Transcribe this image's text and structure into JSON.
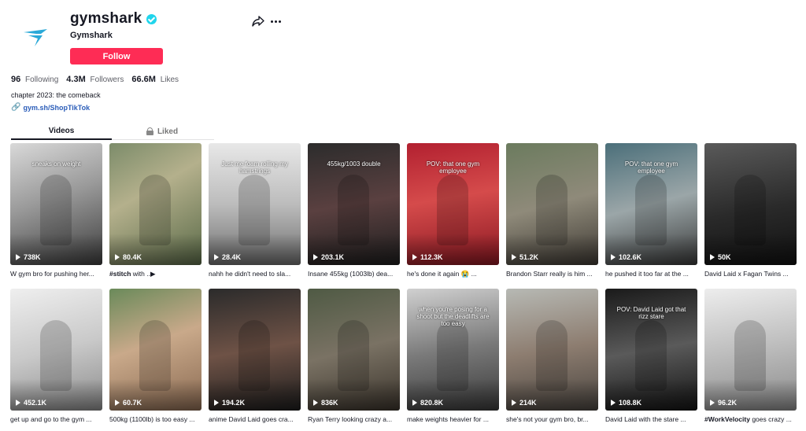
{
  "profile": {
    "username": "gymshark",
    "nickname": "Gymshark",
    "follow_label": "Follow",
    "brand_color": "#fe2c55",
    "verified_color": "#20d5ec"
  },
  "stats": {
    "following_count": "96",
    "following_label": "Following",
    "followers_count": "4.3M",
    "followers_label": "Followers",
    "likes_count": "66.6M",
    "likes_label": "Likes"
  },
  "bio": "chapter 2023: the comeback",
  "link": "gym.sh/ShopTikTok",
  "tabs": {
    "videos": "Videos",
    "liked": "Liked"
  },
  "videos": [
    {
      "views": "738K",
      "desc": "W gym bro for pushing her...",
      "overlay": "sneaks on weight"
    },
    {
      "views": "80.4K",
      "desc": "#stitch with ..▶",
      "overlay": ""
    },
    {
      "views": "28.4K",
      "desc": "nahh he didn't need to sla...",
      "overlay": "Just me foam rolling my hamstrings"
    },
    {
      "views": "203.1K",
      "desc": "Insane 455kg (1003lb) dea...",
      "overlay": "455kg/1003 double"
    },
    {
      "views": "112.3K",
      "desc": "he's done it again 😭 ...",
      "overlay": "POV: that one gym employee"
    },
    {
      "views": "51.2K",
      "desc": "Brandon Starr really is him ...",
      "overlay": ""
    },
    {
      "views": "102.6K",
      "desc": "he pushed it too far at the ...",
      "overlay": "POV: that one gym employee"
    },
    {
      "views": "50K",
      "desc": "David Laid x Fagan Twins ...",
      "overlay": ""
    },
    {
      "views": "452.1K",
      "desc": "get up and go to the gym ...",
      "overlay": ""
    },
    {
      "views": "60.7K",
      "desc": "500kg (1100lb) is too easy ...",
      "overlay": ""
    },
    {
      "views": "194.2K",
      "desc": "anime David Laid goes cra...",
      "overlay": ""
    },
    {
      "views": "836K",
      "desc": "Ryan Terry looking crazy a...",
      "overlay": ""
    },
    {
      "views": "820.8K",
      "desc": "make weights heavier for ...",
      "overlay": "when you're posing for a shoot but the deadlifts are too easy"
    },
    {
      "views": "214K",
      "desc": "she's not your gym bro, br...",
      "overlay": ""
    },
    {
      "views": "108.8K",
      "desc": "David Laid with the stare ...",
      "overlay": "POV: David Laid got that rizz stare"
    },
    {
      "views": "96.2K",
      "desc": "#WorkVelocity goes crazy ...",
      "overlay": ""
    }
  ]
}
